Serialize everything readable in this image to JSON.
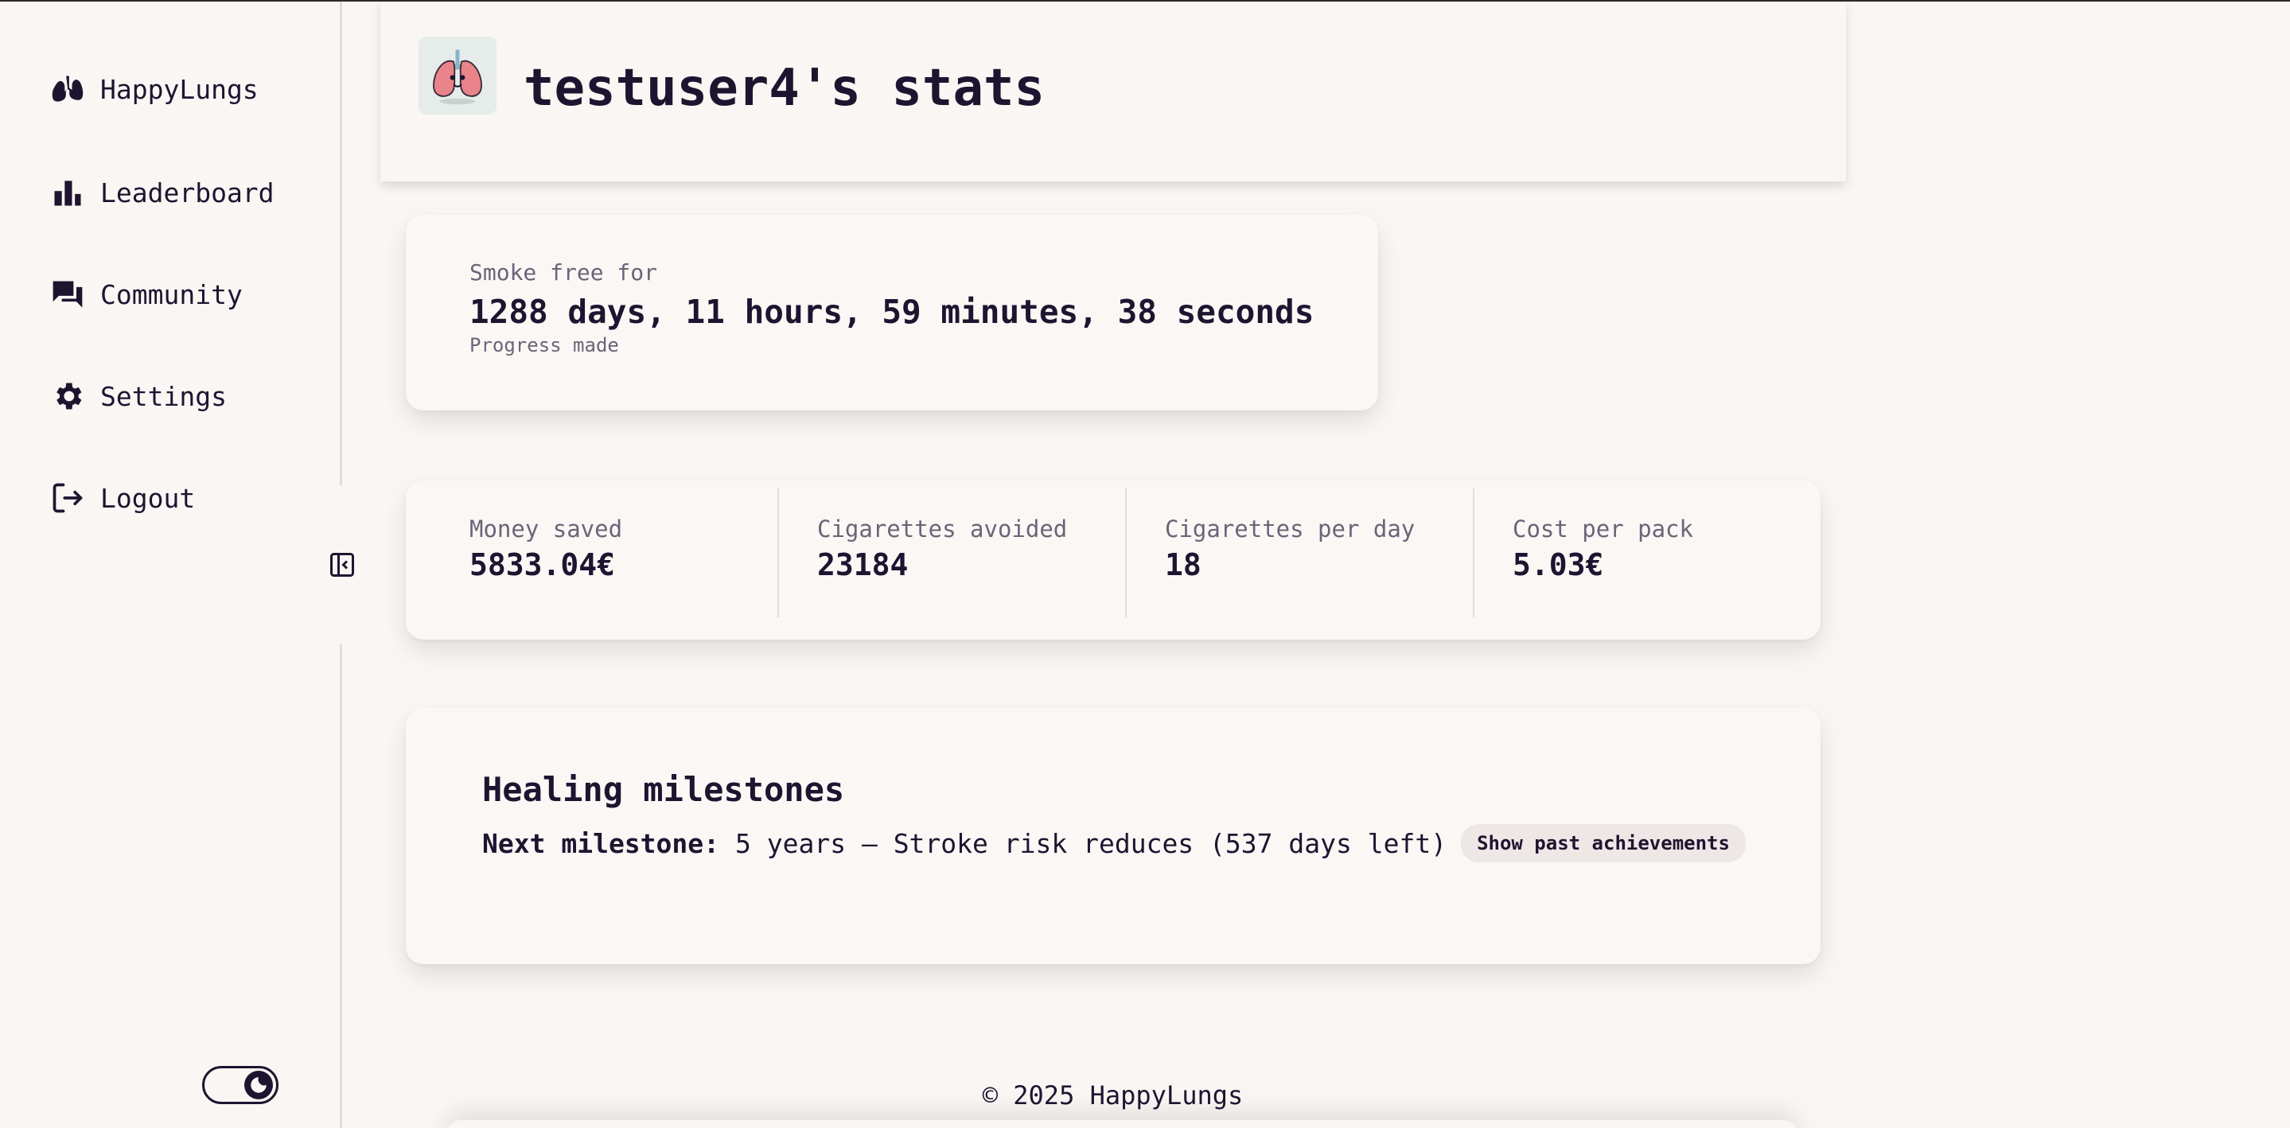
{
  "sidebar": {
    "items": [
      {
        "label": "HappyLungs",
        "icon": "lungs-icon"
      },
      {
        "label": "Leaderboard",
        "icon": "bar-chart-icon"
      },
      {
        "label": "Community",
        "icon": "chat-icon"
      },
      {
        "label": "Settings",
        "icon": "gear-icon"
      },
      {
        "label": "Logout",
        "icon": "logout-icon"
      }
    ],
    "collapse_icon": "collapse-sidebar-icon",
    "theme_toggle_icon": "moon-icon"
  },
  "header": {
    "title": "testuser4's stats",
    "avatar_icon": "lungs-avatar-icon"
  },
  "smoke_free": {
    "label": "Smoke free for",
    "value": "1288 days, 11 hours, 59 minutes, 38 seconds",
    "sub": "Progress made"
  },
  "stats": [
    {
      "label": "Money saved",
      "value": "5833.04€"
    },
    {
      "label": "Cigarettes avoided",
      "value": "23184"
    },
    {
      "label": "Cigarettes per day",
      "value": "18"
    },
    {
      "label": "Cost per pack",
      "value": "5.03€"
    }
  ],
  "milestones": {
    "title": "Healing milestones",
    "next_label": "Next milestone:",
    "next_value": "5 years – Stroke risk reduces (537 days left)",
    "button": "Show past achievements"
  },
  "footer": "© 2025 HappyLungs",
  "colors": {
    "background": "#f9f6f4",
    "text": "#1f1430",
    "muted": "#6b6478"
  }
}
